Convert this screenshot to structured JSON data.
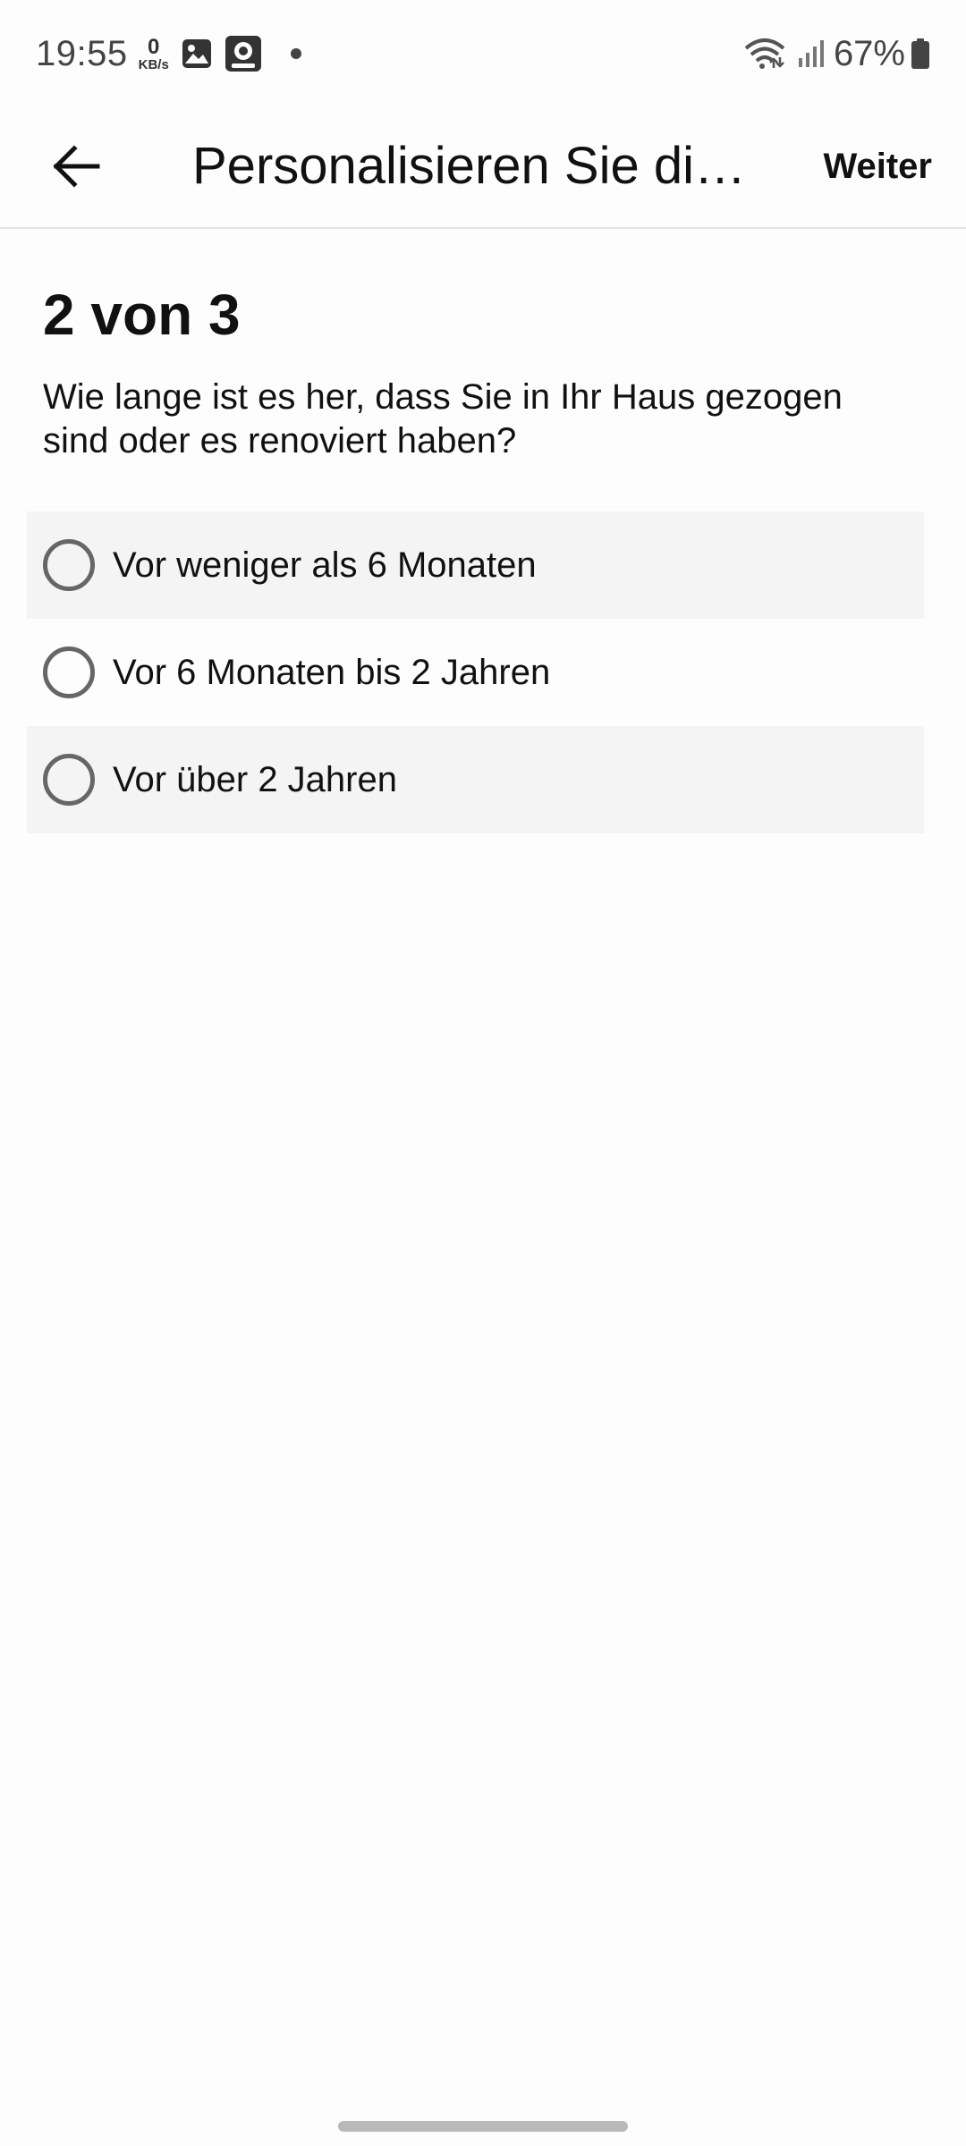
{
  "status_bar": {
    "time": "19:55",
    "data_rate_value": "0",
    "data_rate_unit": "KB/s",
    "battery": "67%",
    "icons": [
      "gallery-icon",
      "camera-app-icon",
      "notification-dot-icon",
      "wifi-icon",
      "signal-icon",
      "battery-icon"
    ]
  },
  "app_bar": {
    "back_icon": "arrow-left-icon",
    "title": "Personalisieren Sie di…",
    "next_label": "Weiter"
  },
  "step": {
    "heading": "2 von 3",
    "question": "Wie lange ist es her, dass Sie in Ihr Haus gezogen sind oder es renoviert haben?",
    "options": [
      {
        "label": "Vor weniger als 6 Monaten",
        "selected": false
      },
      {
        "label": "Vor 6 Monaten bis 2 Jahren",
        "selected": false
      },
      {
        "label": "Vor über 2 Jahren",
        "selected": false
      }
    ]
  },
  "colors": {
    "background": "#fdfdfd",
    "option_shade": "#f4f4f4",
    "radio_border": "#666666",
    "text": "#111111"
  }
}
